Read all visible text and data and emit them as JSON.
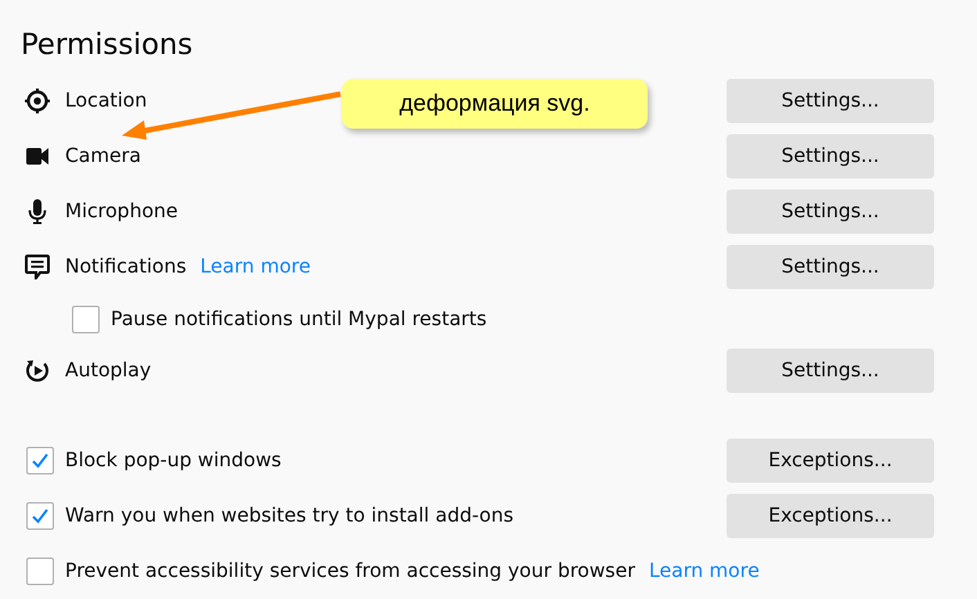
{
  "heading": "Permissions",
  "permissions": [
    {
      "label": "Location",
      "button": "Settings..."
    },
    {
      "label": "Camera",
      "button": "Settings..."
    },
    {
      "label": "Microphone",
      "button": "Settings..."
    },
    {
      "label": "Notifications",
      "link": "Learn more",
      "button": "Settings...",
      "children": [
        {
          "label": "Pause notifications until Mypal restarts",
          "checked": false
        }
      ]
    },
    {
      "label": "Autoplay",
      "button": "Settings..."
    }
  ],
  "options": [
    {
      "label": "Block pop-up windows",
      "checked": true,
      "button": "Exceptions..."
    },
    {
      "label": "Warn you when websites try to install add-ons",
      "checked": true,
      "button": "Exceptions..."
    },
    {
      "label": "Prevent accessibility services from accessing your browser",
      "checked": false,
      "link": "Learn more"
    }
  ],
  "callout": {
    "text": "деформация svg."
  }
}
